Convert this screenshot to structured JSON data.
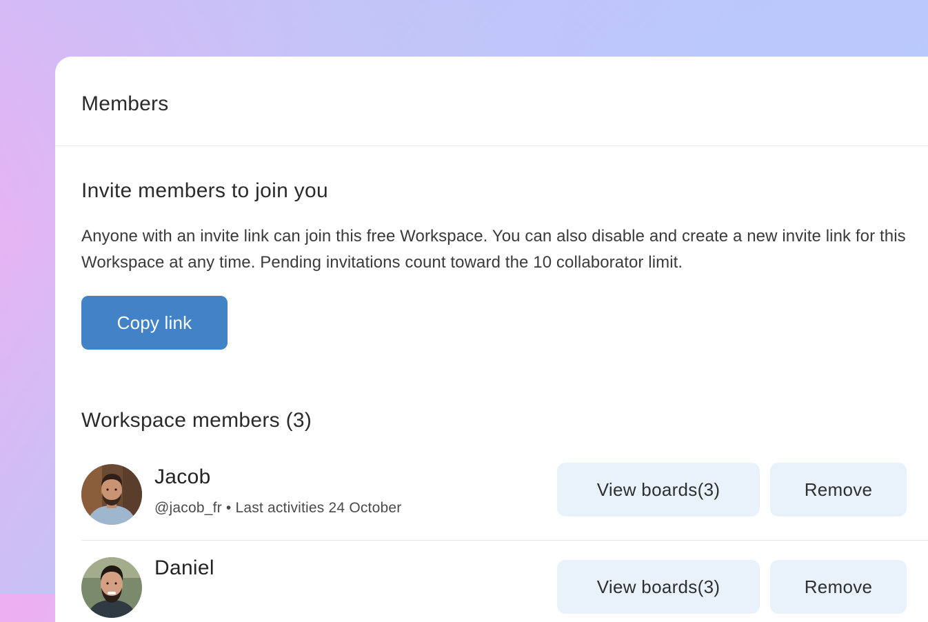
{
  "panel": {
    "title": "Members"
  },
  "invite": {
    "title": "Invite members to join you",
    "description": "Anyone with an invite link can join this free Workspace. You can also disable and create a new invite link for this Workspace at any time. Pending invitations count toward the 10 collaborator limit.",
    "copy_button_label": "Copy link"
  },
  "members": {
    "title": "Workspace members (3)",
    "items": [
      {
        "name": "Jacob",
        "meta": "@jacob_fr • Last activities 24 October",
        "view_boards_label": "View boards(3)",
        "remove_label": "Remove",
        "avatar": "avatar-photo"
      },
      {
        "name": "Daniel",
        "meta": "",
        "view_boards_label": "View boards(3)",
        "remove_label": "Remove",
        "avatar": "avatar-photo"
      }
    ]
  },
  "colors": {
    "primary_button": "#4283c8",
    "soft_button": "#e9f1fb",
    "text_dark": "#2b2b2b"
  }
}
